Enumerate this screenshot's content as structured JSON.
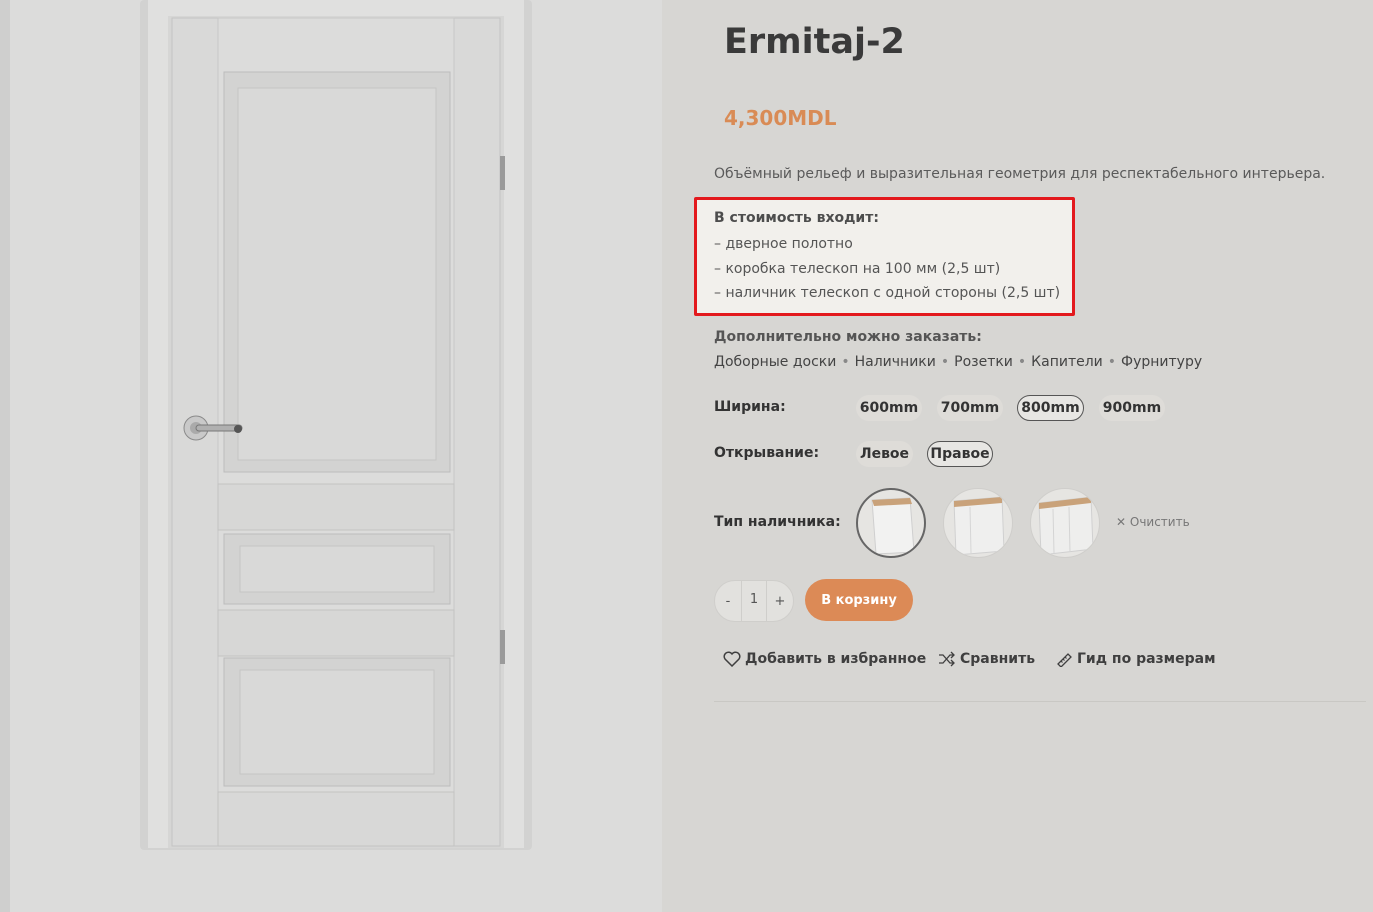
{
  "product": {
    "title": "Ermitaj-2",
    "price": "4,300MDL",
    "description": "Объёмный рельеф и выразительная геометрия для респектабельного интерьера."
  },
  "includes": {
    "title": "В стоимость входит:",
    "items": [
      "– дверное полотно",
      "– коробка телескоп на 100 мм (2,5 шт)",
      "– наличник телескоп с одной стороны (2,5 шт)"
    ]
  },
  "extras": {
    "title": "Дополнительно можно заказать:",
    "items": [
      "Доборные доски",
      "Наличники",
      "Розетки",
      "Капители",
      "Фурнитуру"
    ],
    "separator": "•"
  },
  "width": {
    "label": "Ширина",
    "options": [
      "600mm",
      "700mm",
      "800mm",
      "900mm"
    ],
    "selected": "800mm"
  },
  "opening": {
    "label": "Открывание",
    "options": [
      "Левое",
      "Правое"
    ],
    "selected": "Правое"
  },
  "casing": {
    "label": "Тип наличника",
    "clear_label": "Очистить",
    "selected_index": 0
  },
  "cart": {
    "qty_minus": "-",
    "qty_value": "1",
    "qty_plus": "+",
    "add_label": "В корзину"
  },
  "actions": {
    "wishlist": "Добавить в избранное",
    "compare": "Сравнить",
    "size_guide": "Гид по размерам"
  },
  "colors": {
    "accent": "#dc8a56",
    "price": "#d98b55",
    "highlight_border": "#e3191d"
  }
}
